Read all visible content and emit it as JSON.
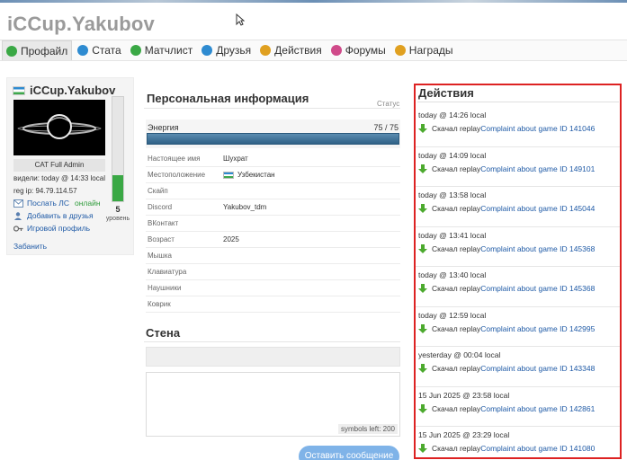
{
  "site": {
    "title": "iCCup.Yakubov"
  },
  "tabs": [
    {
      "label": "Профайл",
      "icon": "profile-icon",
      "color": "#3aa845",
      "active": true
    },
    {
      "label": "Стата",
      "icon": "stats-icon",
      "color": "#2e8bd1",
      "active": false
    },
    {
      "label": "Матчлист",
      "icon": "matchlist-icon",
      "color": "#3aa845",
      "active": false
    },
    {
      "label": "Друзья",
      "icon": "friends-icon",
      "color": "#2e8bd1",
      "active": false
    },
    {
      "label": "Действия",
      "icon": "actions-icon",
      "color": "#e0a020",
      "active": false
    },
    {
      "label": "Форумы",
      "icon": "forums-icon",
      "color": "#d04a8a",
      "active": false
    },
    {
      "label": "Награды",
      "icon": "awards-icon",
      "color": "#e0a020",
      "active": false
    }
  ],
  "card": {
    "name": "iCCup.Yakubov",
    "rank": "CAT Full Admin",
    "seen": "видели: today @ 14:33 local",
    "reg_ip": "reg ip: 94.79.114.57",
    "send_pm": "Послать ЛС",
    "online": "онлайн",
    "add_friend": "Добавить в друзья",
    "game_profile": "Игровой профиль",
    "ban": "Забанить",
    "level": "5",
    "level_label": "уровень",
    "level_fraction": 0.25
  },
  "personal": {
    "title": "Персональная информация",
    "status_label": "Статус",
    "energy_label": "Энергия",
    "energy_value": "75 / 75",
    "energy_fraction": 1.0,
    "rows": [
      {
        "label": "Настоящее имя",
        "value": "Шухрат"
      },
      {
        "label": "Местоположение",
        "value": "Узбекистан",
        "flag": true
      },
      {
        "label": "Скайп",
        "value": ""
      },
      {
        "label": "Discord",
        "value": "Yakubov_tdm"
      },
      {
        "label": "ВКонтакт",
        "value": ""
      },
      {
        "label": "Возраст",
        "value": "2025"
      },
      {
        "label": "Мышка",
        "value": ""
      },
      {
        "label": "Клавиатура",
        "value": ""
      },
      {
        "label": "Наушники",
        "value": ""
      },
      {
        "label": "Коврик",
        "value": ""
      }
    ]
  },
  "wall": {
    "title": "Стена",
    "symbols_left": "symbols left: 200",
    "send_label": "Оставить сообщение"
  },
  "actions": {
    "title": "Действия",
    "items": [
      {
        "time": "today @ 14:26 local",
        "text": "Скачал replay",
        "link": "Complaint about game ID 141046"
      },
      {
        "time": "today @ 14:09 local",
        "text": "Скачал replay",
        "link": "Complaint about game ID 149101"
      },
      {
        "time": "today @ 13:58 local",
        "text": "Скачал replay",
        "link": "Complaint about game ID 145044"
      },
      {
        "time": "today @ 13:41 local",
        "text": "Скачал replay",
        "link": "Complaint about game ID 145368"
      },
      {
        "time": "today @ 13:40 local",
        "text": "Скачал replay",
        "link": "Complaint about game ID 145368"
      },
      {
        "time": "today @ 12:59 local",
        "text": "Скачал replay",
        "link": "Complaint about game ID 142995"
      },
      {
        "time": "yesterday @ 00:04 local",
        "text": "Скачал replay",
        "link": "Complaint about game ID 143348"
      },
      {
        "time": "15 Jun 2025 @ 23:58 local",
        "text": "Скачал replay",
        "link": "Complaint about game ID 142861"
      },
      {
        "time": "15 Jun 2025 @ 23:29 local",
        "text": "Скачал replay",
        "link": "Complaint about game ID 141080"
      }
    ]
  },
  "colors": {
    "link": "#1f5aa6",
    "accent_red": "#dd2222",
    "green": "#3aa845"
  }
}
